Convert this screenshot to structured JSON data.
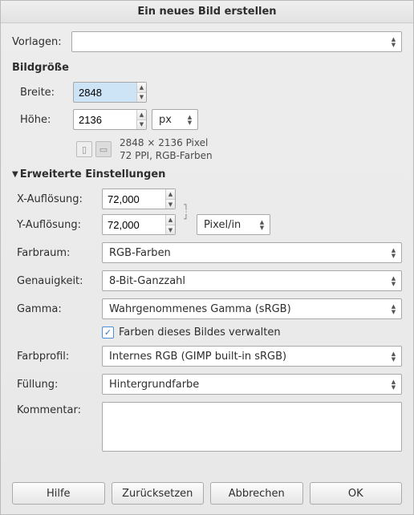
{
  "title": "Ein neues Bild erstellen",
  "templates": {
    "label": "Vorlagen:",
    "value": ""
  },
  "imageSize": {
    "heading": "Bildgröße",
    "widthLabel": "Breite:",
    "heightLabel": "Höhe:",
    "width": "2848",
    "height": "2136",
    "unit": "px",
    "infoLine1": "2848 × 2136 Pixel",
    "infoLine2": "72 PPI, RGB-Farben"
  },
  "advanced": {
    "heading": "Erweiterte Einstellungen",
    "xResLabel": "X-Auflösung:",
    "yResLabel": "Y-Auflösung:",
    "xRes": "72,000",
    "yRes": "72,000",
    "resUnit": "Pixel/in",
    "colorspaceLabel": "Farbraum:",
    "colorspace": "RGB-Farben",
    "precisionLabel": "Genauigkeit:",
    "precision": "8-Bit-Ganzzahl",
    "gammaLabel": "Gamma:",
    "gamma": "Wahrgenommenes Gamma (sRGB)",
    "manageColorsLabel": "Farben dieses Bildes verwalten",
    "profileLabel": "Farbprofil:",
    "profile": "Internes RGB (GIMP built-in sRGB)",
    "fillLabel": "Füllung:",
    "fill": "Hintergrundfarbe",
    "commentLabel": "Kommentar:",
    "comment": ""
  },
  "buttons": {
    "help": "Hilfe",
    "reset": "Zurücksetzen",
    "cancel": "Abbrechen",
    "ok": "OK"
  }
}
